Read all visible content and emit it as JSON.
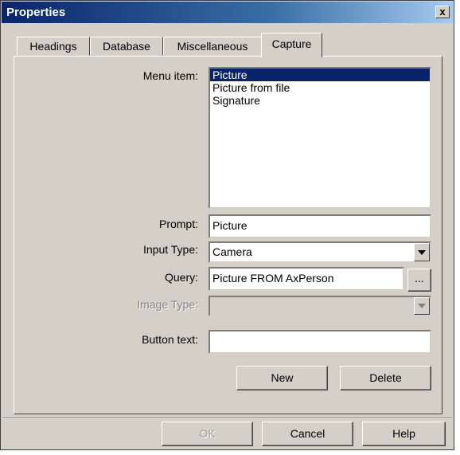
{
  "window": {
    "title": "Properties",
    "close_label": "x"
  },
  "tabs": [
    {
      "label": "Headings"
    },
    {
      "label": "Database"
    },
    {
      "label": "Miscellaneous"
    },
    {
      "label": "Capture",
      "active": true
    }
  ],
  "capture": {
    "menu_item_label": "Menu item:",
    "menu_items": [
      "Picture",
      "Picture from file",
      "Signature"
    ],
    "selected_menu_item": "Picture",
    "prompt_label": "Prompt:",
    "prompt_value": "Picture",
    "input_type_label": "Input Type:",
    "input_type_value": "Camera",
    "query_label": "Query:",
    "query_value": "Picture FROM AxPerson",
    "browse_label": "...",
    "image_type_label": "Image Type:",
    "image_type_value": "",
    "button_text_label": "Button text:",
    "button_text_value": "",
    "new_label": "New",
    "delete_label": "Delete"
  },
  "footer": {
    "ok_label": "OK",
    "cancel_label": "Cancel",
    "help_label": "Help"
  },
  "colors": {
    "face": "#d4d0c8",
    "titlebar": "#0a246a",
    "selection": "#0a246a"
  }
}
